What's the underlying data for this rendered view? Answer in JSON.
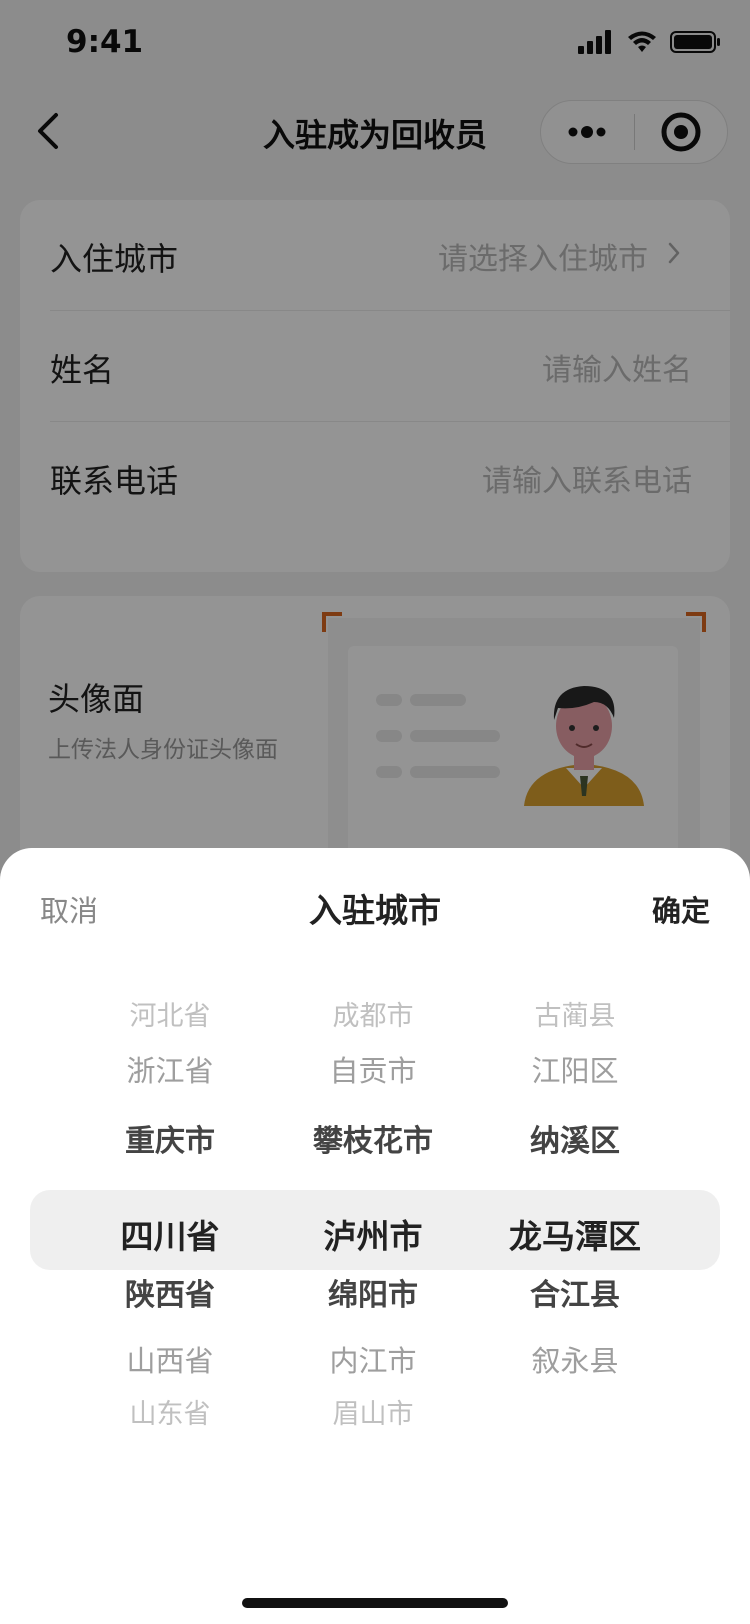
{
  "status_bar": {
    "time": "9:41"
  },
  "nav": {
    "title": "入驻成为回收员"
  },
  "form": {
    "rows": [
      {
        "label": "入住城市",
        "value": "请选择入住城市"
      },
      {
        "label": "姓名",
        "value": "请输入姓名"
      },
      {
        "label": "联系电话",
        "value": "请输入联系电话"
      }
    ]
  },
  "id_card": {
    "title": "头像面",
    "subtitle": "上传法人身份证头像面"
  },
  "sheet": {
    "cancel": "取消",
    "title": "入驻城市",
    "confirm": "确定"
  },
  "picker": {
    "provinces": [
      "河北省",
      "浙江省",
      "重庆市",
      "四川省",
      "陕西省",
      "山西省",
      "山东省"
    ],
    "cities": [
      "成都市",
      "自贡市",
      "攀枝花市",
      "泸州市",
      "绵阳市",
      "内江市",
      "眉山市"
    ],
    "districts": [
      "古蔺县",
      "江阳区",
      "纳溪区",
      "龙马潭区",
      "合江县",
      "叙永县"
    ],
    "selected": {
      "province": "四川省",
      "city": "泸州市",
      "district": "龙马潭区"
    }
  },
  "colors": {
    "accent_corner": "#d9661f",
    "overlay": "rgba(0,0,0,0.42)"
  }
}
